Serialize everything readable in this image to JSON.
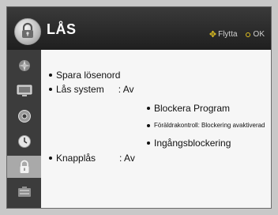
{
  "header": {
    "title": "LÅS",
    "hint_move": "Flytta",
    "hint_ok": "OK"
  },
  "sidebar": {
    "items": [
      {
        "icon": "picture-icon"
      },
      {
        "icon": "screen-icon"
      },
      {
        "icon": "options-icon"
      },
      {
        "icon": "clock-icon"
      },
      {
        "icon": "lock-icon",
        "active": true
      },
      {
        "icon": "input-icon"
      }
    ]
  },
  "menu": {
    "spara_losenord": "Spara lösenord",
    "las_system_label": "Lås system",
    "las_system_value": ": Av",
    "blockera_program": "Blockera Program",
    "foraldrakontroll": "Föräldrakontroll: Blockering avaktiverad",
    "ingangsblockering": "Ingångsblockering",
    "knapplas_label": "Knapplås",
    "knapplas_value": ": Av"
  },
  "colors": {
    "background": "#c8c8c8",
    "panel": "#f6f6f6",
    "header": "#2b2b2b",
    "accent": "#e0c020"
  }
}
